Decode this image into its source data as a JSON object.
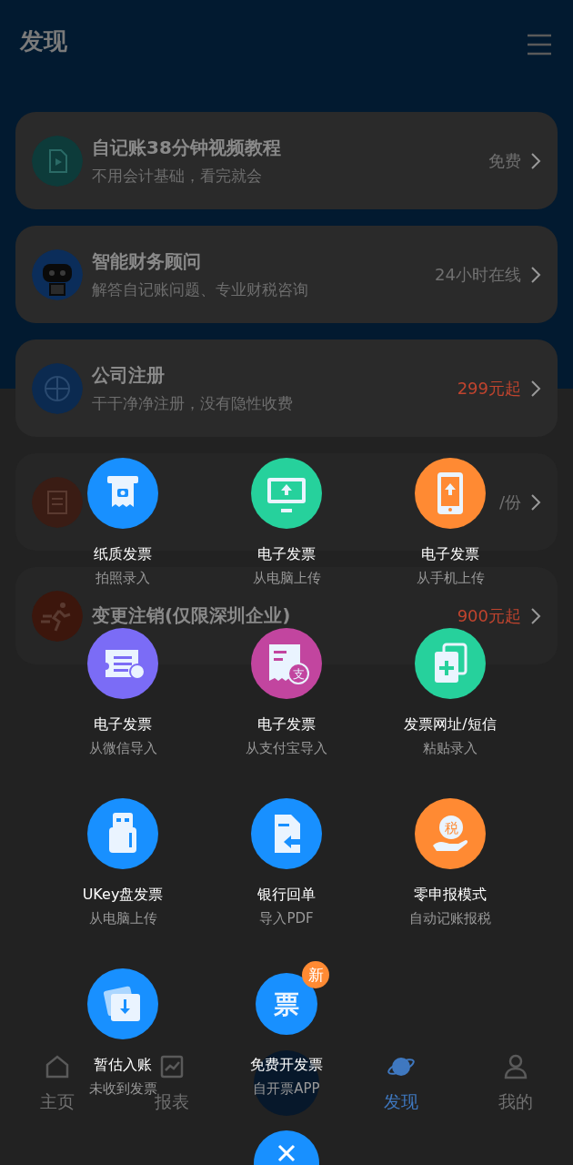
{
  "header": {
    "title": "发现"
  },
  "cards": [
    {
      "kind": "video",
      "color": "#0d3b3a",
      "title": "自记账38分钟视频教程",
      "subtitle": "不用会计基础，看完就会",
      "price": "免费",
      "highlight": false
    },
    {
      "kind": "robot",
      "color": "#0b2d5a",
      "title": "智能财务顾问",
      "subtitle": "解答自记账问题、专业财税咨询",
      "price": "24小时在线",
      "highlight": false
    },
    {
      "kind": "company",
      "color": "#0b2a50",
      "title": "公司注册",
      "subtitle": "干干净净注册，没有隐性收费",
      "price": "299元起",
      "highlight": true
    },
    {
      "kind": "report",
      "color": "#3a1c14",
      "price": "/份",
      "highlight": false
    },
    {
      "kind": "runner",
      "color": "#3c160c",
      "title": "变更注销(仅限深圳企业)",
      "price": "900元起",
      "highlight": true
    }
  ],
  "tab_bar": [
    {
      "kind": "home",
      "label": "主页",
      "selected": false
    },
    {
      "kind": "chart",
      "label": "报表",
      "selected": false
    },
    {
      "kind": "planet",
      "label": "发现",
      "selected": true
    },
    {
      "kind": "person",
      "label": "我的",
      "selected": false
    }
  ],
  "sheet": {
    "items": [
      {
        "kind": "receipt-camera",
        "color": "#1890ff",
        "title": "纸质发票",
        "subtitle": "拍照录入"
      },
      {
        "kind": "monitor-upload",
        "color": "#26d19c",
        "title": "电子发票",
        "subtitle": "从电脑上传"
      },
      {
        "kind": "tablet-upload",
        "color": "#ff8a33",
        "title": "电子发票",
        "subtitle": "从手机上传"
      },
      {
        "kind": "chat-invoice",
        "color": "#7b6cf6",
        "title": "电子发票",
        "subtitle": "从微信导入"
      },
      {
        "kind": "alipay-receipt",
        "color": "#c2459f",
        "icon_text": "支",
        "title": "电子发票",
        "subtitle": "从支付宝导入"
      },
      {
        "kind": "copy-plus",
        "color": "#26d19c",
        "title": "发票网址/短信",
        "subtitle": "粘贴录入"
      },
      {
        "kind": "usb",
        "color": "#1890ff",
        "title": "UKey盘发票",
        "subtitle": "从电脑上传"
      },
      {
        "kind": "doc-arrow",
        "color": "#1890ff",
        "title": "银行回单",
        "subtitle": "导入PDF"
      },
      {
        "kind": "tax-hand",
        "color": "#ff8a33",
        "icon_text": "税",
        "title": "零申报模式",
        "subtitle": "自动记账报税"
      },
      {
        "kind": "tray-download",
        "color": "#1890ff",
        "title": "暂估入账",
        "subtitle": "未收到发票"
      },
      {
        "kind": "ticket",
        "color": "#1890ff",
        "icon_text": "票",
        "badge": "新",
        "title": "免费开发票",
        "subtitle": "自开票APP"
      }
    ]
  }
}
